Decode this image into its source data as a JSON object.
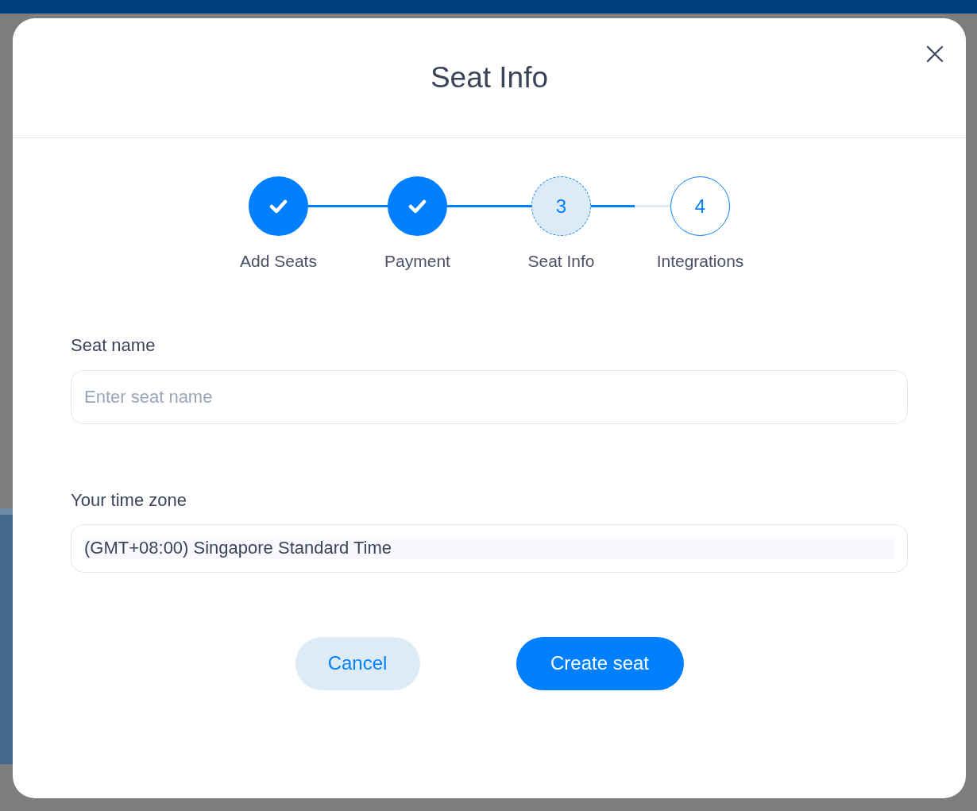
{
  "dialog": {
    "title": "Seat Info"
  },
  "steps": [
    {
      "label": "Add Seats",
      "kind": "done"
    },
    {
      "label": "Payment",
      "kind": "done"
    },
    {
      "label": "Seat Info",
      "kind": "current",
      "number": "3"
    },
    {
      "label": "Integrations",
      "kind": "upcoming",
      "number": "4"
    }
  ],
  "connectors": [
    {
      "level": 1
    },
    {
      "level": 1
    },
    {
      "level": 0.55
    }
  ],
  "fields": [
    {
      "label": "Seat name",
      "kind": "text",
      "placeholder": "Enter seat name"
    },
    {
      "label": "Your time zone",
      "kind": "select",
      "value": "(GMT+08:00) Singapore Standard Time"
    }
  ],
  "buttons": [
    {
      "label": "Cancel",
      "kind": "secondary"
    },
    {
      "label": "Create seat",
      "kind": "primary"
    }
  ]
}
